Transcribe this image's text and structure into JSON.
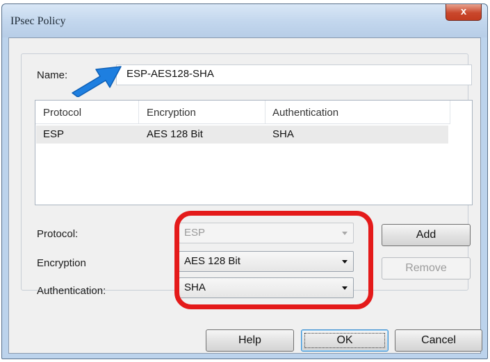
{
  "window": {
    "title": "IPsec Policy",
    "close_label": "x"
  },
  "name": {
    "label": "Name:",
    "value": "ESP-AES128-SHA"
  },
  "list": {
    "columns": [
      "Protocol",
      "Encryption",
      "Authentication"
    ],
    "rows": [
      {
        "protocol": "ESP",
        "encryption": "AES 128 Bit",
        "authentication": "SHA"
      }
    ]
  },
  "fields": {
    "protocol": {
      "label": "Protocol:",
      "value": "ESP",
      "disabled": true
    },
    "encryption": {
      "label": "Encryption",
      "value": "AES 128 Bit"
    },
    "authentication": {
      "label": "Authentication:",
      "value": "SHA"
    }
  },
  "buttons": {
    "add": "Add",
    "remove": "Remove",
    "help": "Help",
    "ok": "OK",
    "cancel": "Cancel"
  },
  "colors": {
    "highlight": "#e41a1a",
    "pointer_arrow": "#1e7fe0",
    "title_bg": "#c2d6ed"
  },
  "icons": {
    "pointer": "arrow-pointer-icon",
    "close": "close-icon",
    "dropdown": "chevron-down-icon"
  }
}
